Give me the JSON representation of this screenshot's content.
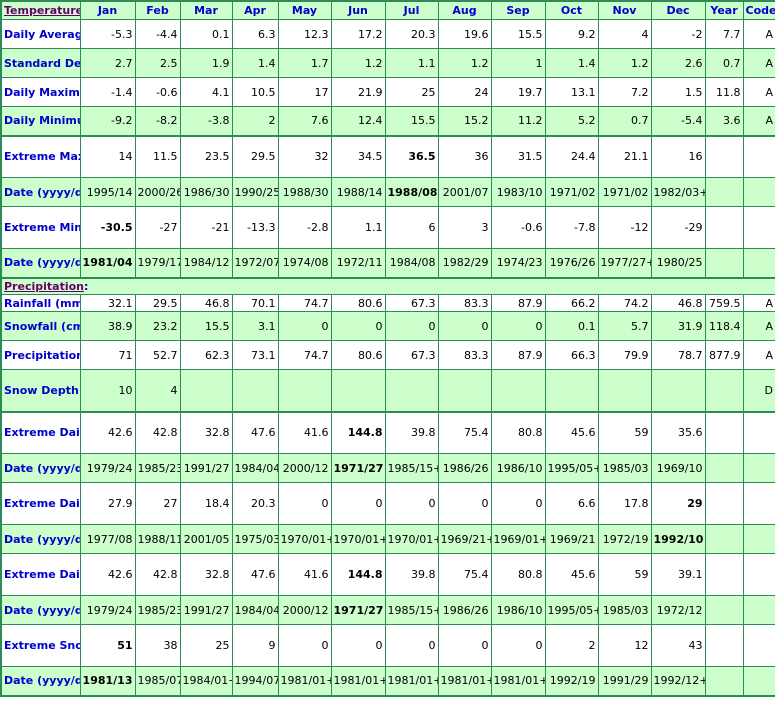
{
  "header": {
    "section_label": "Temperature",
    "columns": [
      "Jan",
      "Feb",
      "Mar",
      "Apr",
      "May",
      "Jun",
      "Jul",
      "Aug",
      "Sep",
      "Oct",
      "Nov",
      "Dec",
      "Year",
      "Code"
    ]
  },
  "temperature_rows": [
    {
      "label": "Daily Average (°C)",
      "values": [
        "-5.3",
        "-4.4",
        "0.1",
        "6.3",
        "12.3",
        "17.2",
        "20.3",
        "19.6",
        "15.5",
        "9.2",
        "4",
        "-2",
        "7.7"
      ],
      "code": "A",
      "bold": []
    },
    {
      "label": "Standard Deviation",
      "values": [
        "2.7",
        "2.5",
        "1.9",
        "1.4",
        "1.7",
        "1.2",
        "1.1",
        "1.2",
        "1",
        "1.4",
        "1.2",
        "2.6",
        "0.7"
      ],
      "code": "A",
      "bold": []
    },
    {
      "label": "Daily Maximum (°C)",
      "values": [
        "-1.4",
        "-0.6",
        "4.1",
        "10.5",
        "17",
        "21.9",
        "25",
        "24",
        "19.7",
        "13.1",
        "7.2",
        "1.5",
        "11.8"
      ],
      "code": "A",
      "bold": []
    },
    {
      "label": "Daily Minimum (°C)",
      "values": [
        "-9.2",
        "-8.2",
        "-3.8",
        "2",
        "7.6",
        "12.4",
        "15.5",
        "15.2",
        "11.2",
        "5.2",
        "0.7",
        "-5.4",
        "3.6"
      ],
      "code": "A",
      "bold": []
    },
    {
      "label": "Extreme Maximum (°C)",
      "values": [
        "14",
        "11.5",
        "23.5",
        "29.5",
        "32",
        "34.5",
        "36.5",
        "36",
        "31.5",
        "24.4",
        "21.1",
        "16",
        ""
      ],
      "code": "",
      "bold": [
        6
      ]
    },
    {
      "label": "Date (yyyy/dd)",
      "values": [
        "1995/14",
        "2000/26",
        "1986/30",
        "1990/25",
        "1988/30",
        "1988/14",
        "1988/08",
        "2001/07",
        "1983/10",
        "1971/02",
        "1971/02",
        "1982/03+",
        ""
      ],
      "code": "",
      "bold": [
        6
      ]
    },
    {
      "label": "Extreme Minimum (°C)",
      "values": [
        "-30.5",
        "-27",
        "-21",
        "-13.3",
        "-2.8",
        "1.1",
        "6",
        "3",
        "-0.6",
        "-7.8",
        "-12",
        "-29",
        ""
      ],
      "code": "",
      "bold": [
        0
      ]
    },
    {
      "label": "Date (yyyy/dd)",
      "values": [
        "1981/04",
        "1979/17",
        "1984/12",
        "1972/07",
        "1974/08",
        "1972/11",
        "1984/08",
        "1982/29",
        "1974/23",
        "1976/26",
        "1977/27+",
        "1980/25",
        ""
      ],
      "code": "",
      "bold": [
        0
      ]
    }
  ],
  "precip_section_label": "Precipitation",
  "precipitation_rows": [
    {
      "label": "Rainfall (mm)",
      "values": [
        "32.1",
        "29.5",
        "46.8",
        "70.1",
        "74.7",
        "80.6",
        "67.3",
        "83.3",
        "87.9",
        "66.2",
        "74.2",
        "46.8",
        "759.5"
      ],
      "code": "A",
      "bold": []
    },
    {
      "label": "Snowfall (cm)",
      "values": [
        "38.9",
        "23.2",
        "15.5",
        "3.1",
        "0",
        "0",
        "0",
        "0",
        "0",
        "0.1",
        "5.7",
        "31.9",
        "118.4"
      ],
      "code": "A",
      "bold": []
    },
    {
      "label": "Precipitation (mm)",
      "values": [
        "71",
        "52.7",
        "62.3",
        "73.1",
        "74.7",
        "80.6",
        "67.3",
        "83.3",
        "87.9",
        "66.3",
        "79.9",
        "78.7",
        "877.9"
      ],
      "code": "A",
      "bold": []
    },
    {
      "label": "Snow Depth at Month-end (cm)",
      "values": [
        "10",
        "4",
        "",
        "",
        "",
        "",
        "",
        "",
        "",
        "",
        "",
        "",
        ""
      ],
      "code": "D",
      "bold": []
    },
    {
      "label": "Extreme Daily Rainfall (mm)",
      "values": [
        "42.6",
        "42.8",
        "32.8",
        "47.6",
        "41.6",
        "144.8",
        "39.8",
        "75.4",
        "80.8",
        "45.6",
        "59",
        "35.6",
        ""
      ],
      "code": "",
      "bold": [
        5
      ]
    },
    {
      "label": "Date (yyyy/dd)",
      "values": [
        "1979/24",
        "1985/23",
        "1991/27",
        "1984/04",
        "2000/12",
        "1971/27",
        "1985/15+",
        "1986/26",
        "1986/10",
        "1995/05+",
        "1985/03",
        "1969/10",
        ""
      ],
      "code": "",
      "bold": [
        5
      ]
    },
    {
      "label": "Extreme Daily Snowfall (cm)",
      "values": [
        "27.9",
        "27",
        "18.4",
        "20.3",
        "0",
        "0",
        "0",
        "0",
        "0",
        "6.6",
        "17.8",
        "29",
        ""
      ],
      "code": "",
      "bold": [
        11
      ]
    },
    {
      "label": "Date (yyyy/dd)",
      "values": [
        "1977/08",
        "1988/11",
        "2001/05",
        "1975/03",
        "1970/01+",
        "1970/01+",
        "1970/01+",
        "1969/21+",
        "1969/01+",
        "1969/21",
        "1972/19",
        "1992/10",
        ""
      ],
      "code": "",
      "bold": [
        11
      ]
    },
    {
      "label": "Extreme Daily Precipitation (mm)",
      "values": [
        "42.6",
        "42.8",
        "32.8",
        "47.6",
        "41.6",
        "144.8",
        "39.8",
        "75.4",
        "80.8",
        "45.6",
        "59",
        "39.1",
        ""
      ],
      "code": "",
      "bold": [
        5
      ]
    },
    {
      "label": "Date (yyyy/dd)",
      "values": [
        "1979/24",
        "1985/23",
        "1991/27",
        "1984/04",
        "2000/12",
        "1971/27",
        "1985/15+",
        "1986/26",
        "1986/10",
        "1995/05+",
        "1985/03",
        "1972/12",
        ""
      ],
      "code": "",
      "bold": [
        5
      ]
    },
    {
      "label": "Extreme Snow Depth (cm)",
      "values": [
        "51",
        "38",
        "25",
        "9",
        "0",
        "0",
        "0",
        "0",
        "0",
        "2",
        "12",
        "43",
        ""
      ],
      "code": "",
      "bold": [
        0
      ]
    },
    {
      "label": "Date (yyyy/dd)",
      "values": [
        "1981/13",
        "1985/07",
        "1984/01+",
        "1994/07",
        "1981/01+",
        "1981/01+",
        "1981/01+",
        "1981/01+",
        "1981/01+",
        "1992/19",
        "1991/29",
        "1992/12+",
        ""
      ],
      "code": "",
      "bold": [
        0
      ]
    }
  ],
  "colors": {
    "border": "#2e8b57",
    "green_row": "#ccffcc",
    "label_text": "#0000cc",
    "section_link": "#660066"
  }
}
